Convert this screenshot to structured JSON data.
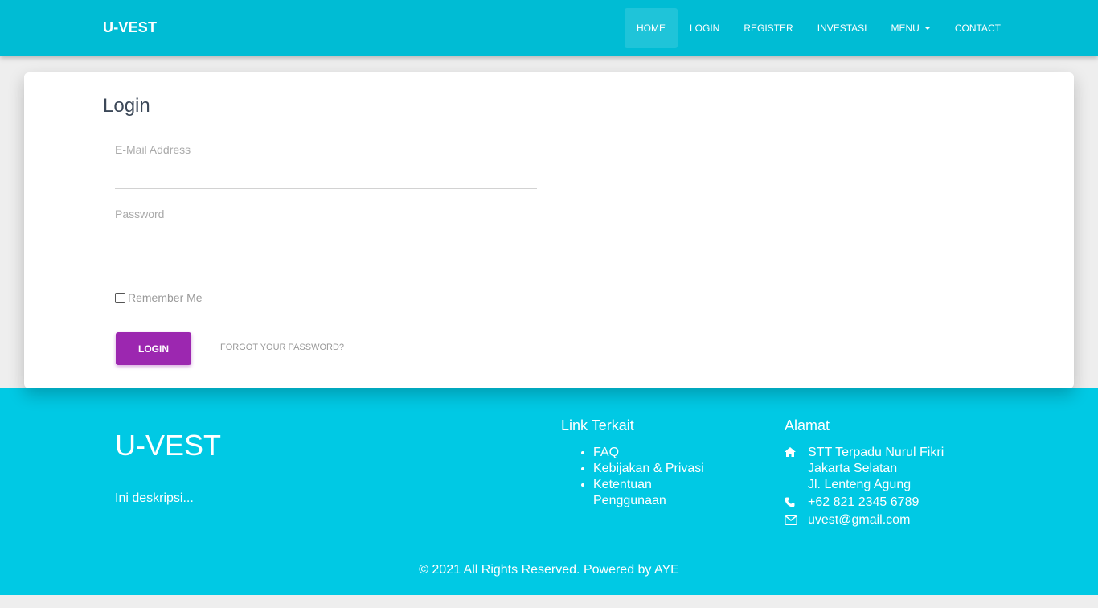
{
  "navbar": {
    "brand": "U-VEST",
    "items": [
      {
        "label": "HOME",
        "active": true
      },
      {
        "label": "LOGIN"
      },
      {
        "label": "REGISTER"
      },
      {
        "label": "INVESTASI"
      },
      {
        "label": "MENU",
        "dropdown": true
      },
      {
        "label": "CONTACT"
      }
    ]
  },
  "login": {
    "title": "Login",
    "email_label": "E-Mail Address",
    "email_value": "",
    "password_label": "Password",
    "password_value": "",
    "remember_label": "Remember Me",
    "remember_checked": false,
    "login_button": "LOGIN",
    "forgot_link": "FORGOT YOUR PASSWORD?"
  },
  "footer": {
    "brand": "U-VEST",
    "description": "Ini deskripsi...",
    "links_heading": "Link Terkait",
    "links": [
      "FAQ",
      "Kebijakan & Privasi",
      "Ketentuan Penggunaan"
    ],
    "address_heading": "Alamat",
    "address_lines": [
      "STT Terpadu Nurul Fikri",
      "Jakarta Selatan",
      "Jl. Lenteng Agung"
    ],
    "phone": "+62 821 2345 6789",
    "email": "uvest@gmail.com",
    "copyright": "© 2021 All Rights Reserved. Powered by AYE",
    "icons": {
      "address": "home-icon",
      "phone": "phone-icon",
      "email": "envelope-icon"
    }
  },
  "colors": {
    "navbar": "#00bcd4",
    "footer": "#00c9e4",
    "primary_button": "#9c27b0",
    "background": "#eeeeee"
  }
}
